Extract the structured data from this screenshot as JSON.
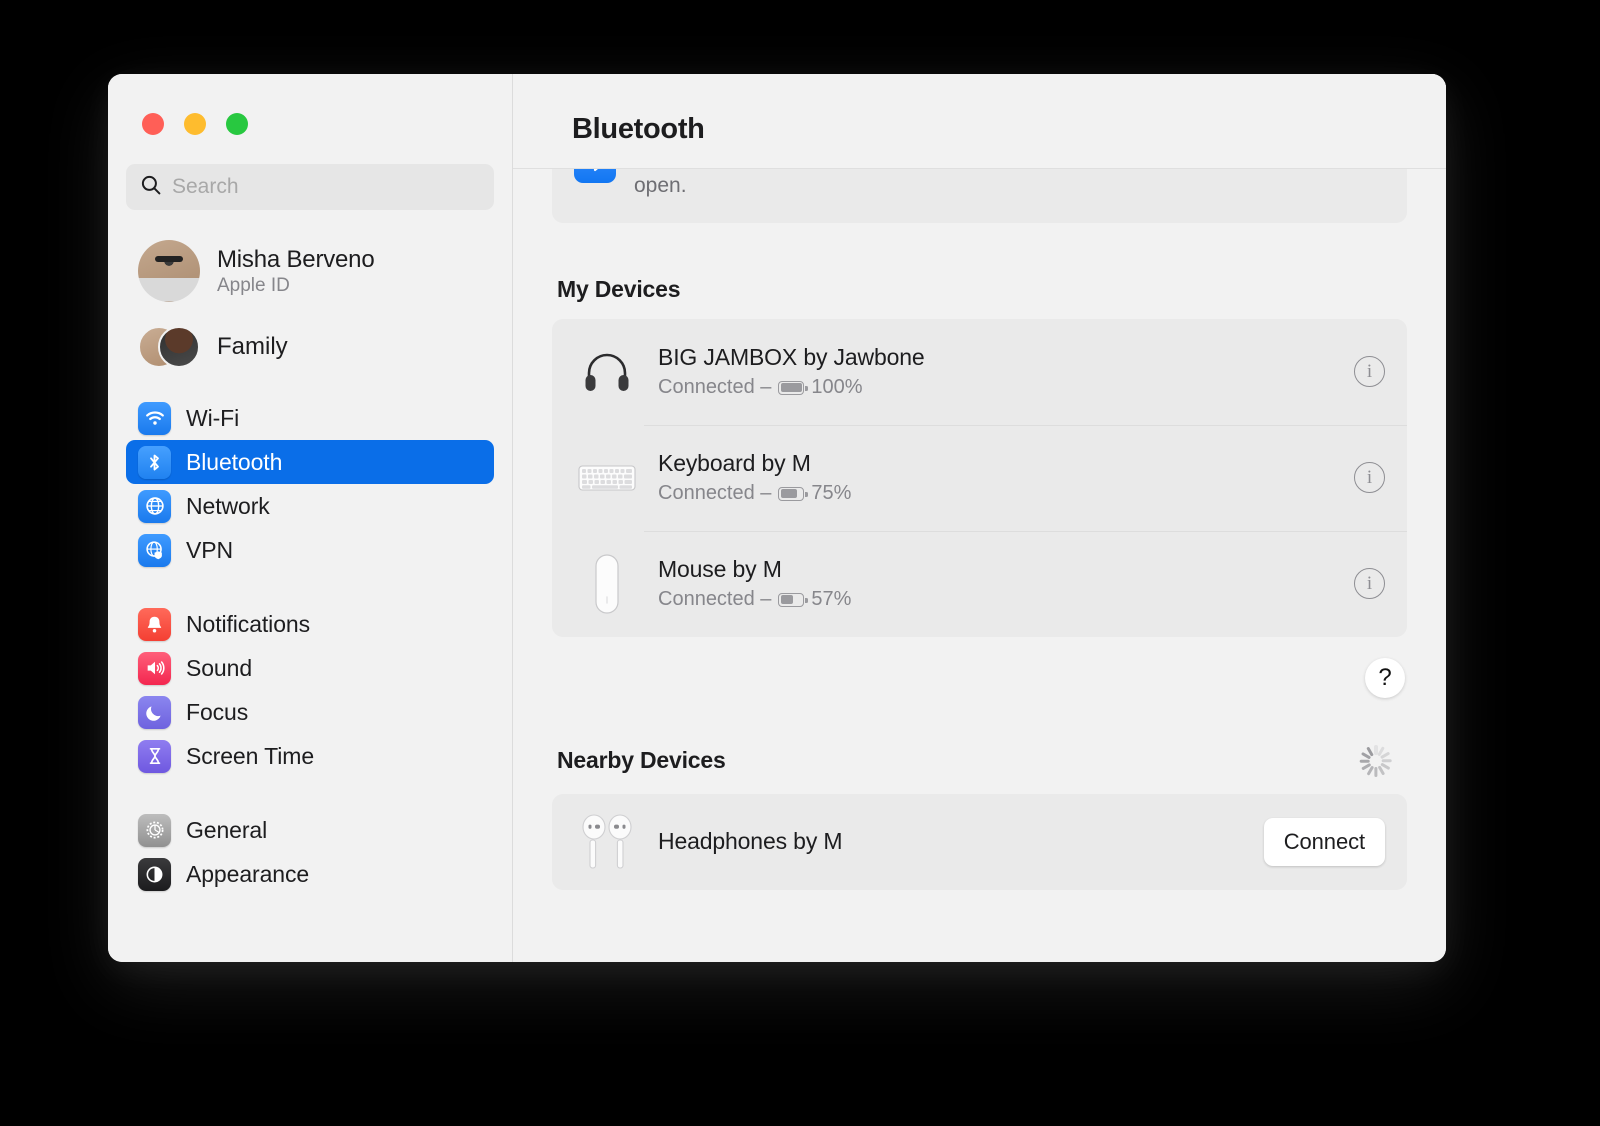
{
  "window": {
    "traffic_lights": [
      "close",
      "minimize",
      "zoom"
    ]
  },
  "search": {
    "placeholder": "Search",
    "value": ""
  },
  "account": {
    "name": "Misha Berveno",
    "subtitle": "Apple ID",
    "family_label": "Family"
  },
  "sidebar": {
    "groups": [
      {
        "items": [
          {
            "label": "Wi-Fi",
            "icon": "wifi-icon",
            "selected": false
          },
          {
            "label": "Bluetooth",
            "icon": "bluetooth-icon",
            "selected": true
          },
          {
            "label": "Network",
            "icon": "globe-icon",
            "selected": false
          },
          {
            "label": "VPN",
            "icon": "vpn-globe-icon",
            "selected": false
          }
        ]
      },
      {
        "items": [
          {
            "label": "Notifications",
            "icon": "bell-icon",
            "selected": false
          },
          {
            "label": "Sound",
            "icon": "speaker-icon",
            "selected": false
          },
          {
            "label": "Focus",
            "icon": "moon-icon",
            "selected": false
          },
          {
            "label": "Screen Time",
            "icon": "hourglass-icon",
            "selected": false
          }
        ]
      },
      {
        "items": [
          {
            "label": "General",
            "icon": "gear-icon",
            "selected": false
          },
          {
            "label": "Appearance",
            "icon": "appearance-icon",
            "selected": false
          }
        ]
      }
    ]
  },
  "header": {
    "title": "Bluetooth"
  },
  "discoverable": {
    "text": "This Mac is discoverable as “Desktop by M” while Bluetooth Settings is open.",
    "toggle_on": true,
    "icon": "bluetooth-icon"
  },
  "my_devices": {
    "title": "My Devices",
    "devices": [
      {
        "name": "BIG JAMBOX by Jawbone",
        "status": "Connected –",
        "battery": "100%",
        "battery_level": 100,
        "icon": "headphones-icon",
        "info_label": "i"
      },
      {
        "name": "Keyboard by M",
        "status": "Connected –",
        "battery": "75%",
        "battery_level": 75,
        "icon": "keyboard-icon",
        "info_label": "i"
      },
      {
        "name": "Mouse by M",
        "status": "Connected –",
        "battery": "57%",
        "battery_level": 57,
        "icon": "mouse-icon",
        "info_label": "i"
      }
    ]
  },
  "help": {
    "label": "?"
  },
  "nearby": {
    "title": "Nearby Devices",
    "spinner": "loading-spinner-icon",
    "devices": [
      {
        "name": "Headphones by M",
        "icon": "airpods-icon",
        "action_label": "Connect"
      }
    ]
  },
  "colors": {
    "accent_blue": "#0a6ee8",
    "toggle_blue": "#0a7cf5",
    "window_bg": "#f2f2f2",
    "card_bg": "#eaeaea",
    "secondary_text": "#86868b"
  }
}
